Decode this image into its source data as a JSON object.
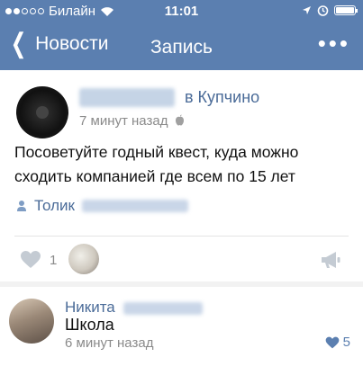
{
  "status_bar": {
    "carrier": "Билайн",
    "time": "11:01"
  },
  "navbar": {
    "back_label": "Новости",
    "title": "Запись",
    "more_label": "•••"
  },
  "post": {
    "group_name": "в Купчино",
    "time": "7 минут назад",
    "text": "Посоветуйте годный квест, куда можно сходить компанией где всем по 15 лет",
    "signer": "Толик",
    "likes": "1"
  },
  "comment": {
    "author": "Никита",
    "text": "Школа",
    "time": "6 минут назад",
    "likes": "5"
  },
  "colors": {
    "header": "#5b7fb0",
    "link": "#4a6b98",
    "muted": "#8a8a8a"
  },
  "icons": [
    "wifi-icon",
    "location-arrow-icon",
    "alarm-icon",
    "battery-icon",
    "back-chevron-icon",
    "more-icon",
    "apple-icon",
    "person-icon",
    "heart-icon",
    "megaphone-icon"
  ]
}
